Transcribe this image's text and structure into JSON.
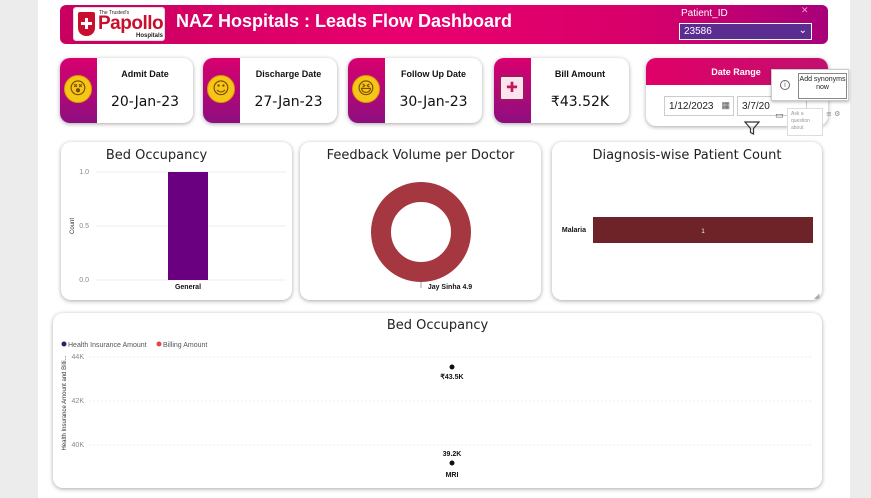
{
  "header": {
    "logo_top": "The Trusted's",
    "logo_main": "Papollo",
    "logo_sub": "Hospitals",
    "title": "NAZ Hospitals : Leads Flow Dashboard",
    "patient_id_label": "Patient_ID",
    "patient_id_value": "23586"
  },
  "cards": [
    {
      "label": "Admit Date",
      "value": "20-Jan-23",
      "icon": "dizzy-face-icon"
    },
    {
      "label": "Discharge Date",
      "value": "27-Jan-23",
      "icon": "smiling-face-icon"
    },
    {
      "label": "Follow Up Date",
      "value": "30-Jan-23",
      "icon": "laughing-face-icon"
    },
    {
      "label": "Bill Amount",
      "value": "₹43.52K",
      "icon": "medical-bill-icon"
    }
  ],
  "date_range": {
    "label": "Date Range",
    "start": "1/12/2023",
    "end": "3/7/20"
  },
  "qa_tooltip": {
    "add_synonyms": "Add synonyms now",
    "ask_placeholder": "Ask a question about"
  },
  "colors": {
    "accent": "#e5006d",
    "purple": "#6a0080",
    "donut": "#a4373f",
    "diag_bar": "#6e2329"
  },
  "chart_data": [
    {
      "type": "bar",
      "title": "Bed Occupancy",
      "categories": [
        "General"
      ],
      "values": [
        1.0
      ],
      "ylabel": "Count",
      "ylim": [
        0,
        1.0
      ],
      "yticks": [
        "0.0",
        "0.5",
        "1.0"
      ]
    },
    {
      "type": "pie",
      "title": "Feedback Volume per Doctor",
      "labels": [
        "Jay Sinha"
      ],
      "values": [
        4.9
      ],
      "data_labels": [
        "Jay Sinha 4.9"
      ]
    },
    {
      "type": "bar",
      "title": "Diagnosis-wise Patient Count",
      "categories": [
        "Malaria"
      ],
      "values": [
        1
      ],
      "orientation": "horizontal",
      "data_labels": [
        "1"
      ]
    },
    {
      "type": "scatter",
      "title": "Bed Occupancy",
      "categories": [
        "MRI"
      ],
      "series": [
        {
          "name": "Health Insurance Amount",
          "values": [
            39200
          ],
          "label": "39.2K",
          "color": "#2b2262"
        },
        {
          "name": "Billing Amount",
          "values": [
            43500
          ],
          "label": "₹43.5K",
          "color": "#e04848"
        }
      ],
      "ylabel": "Health Insurance Amount and Billi...",
      "yticks": [
        "40K",
        "42K",
        "44K"
      ],
      "ylim": [
        39000,
        44500
      ]
    }
  ]
}
